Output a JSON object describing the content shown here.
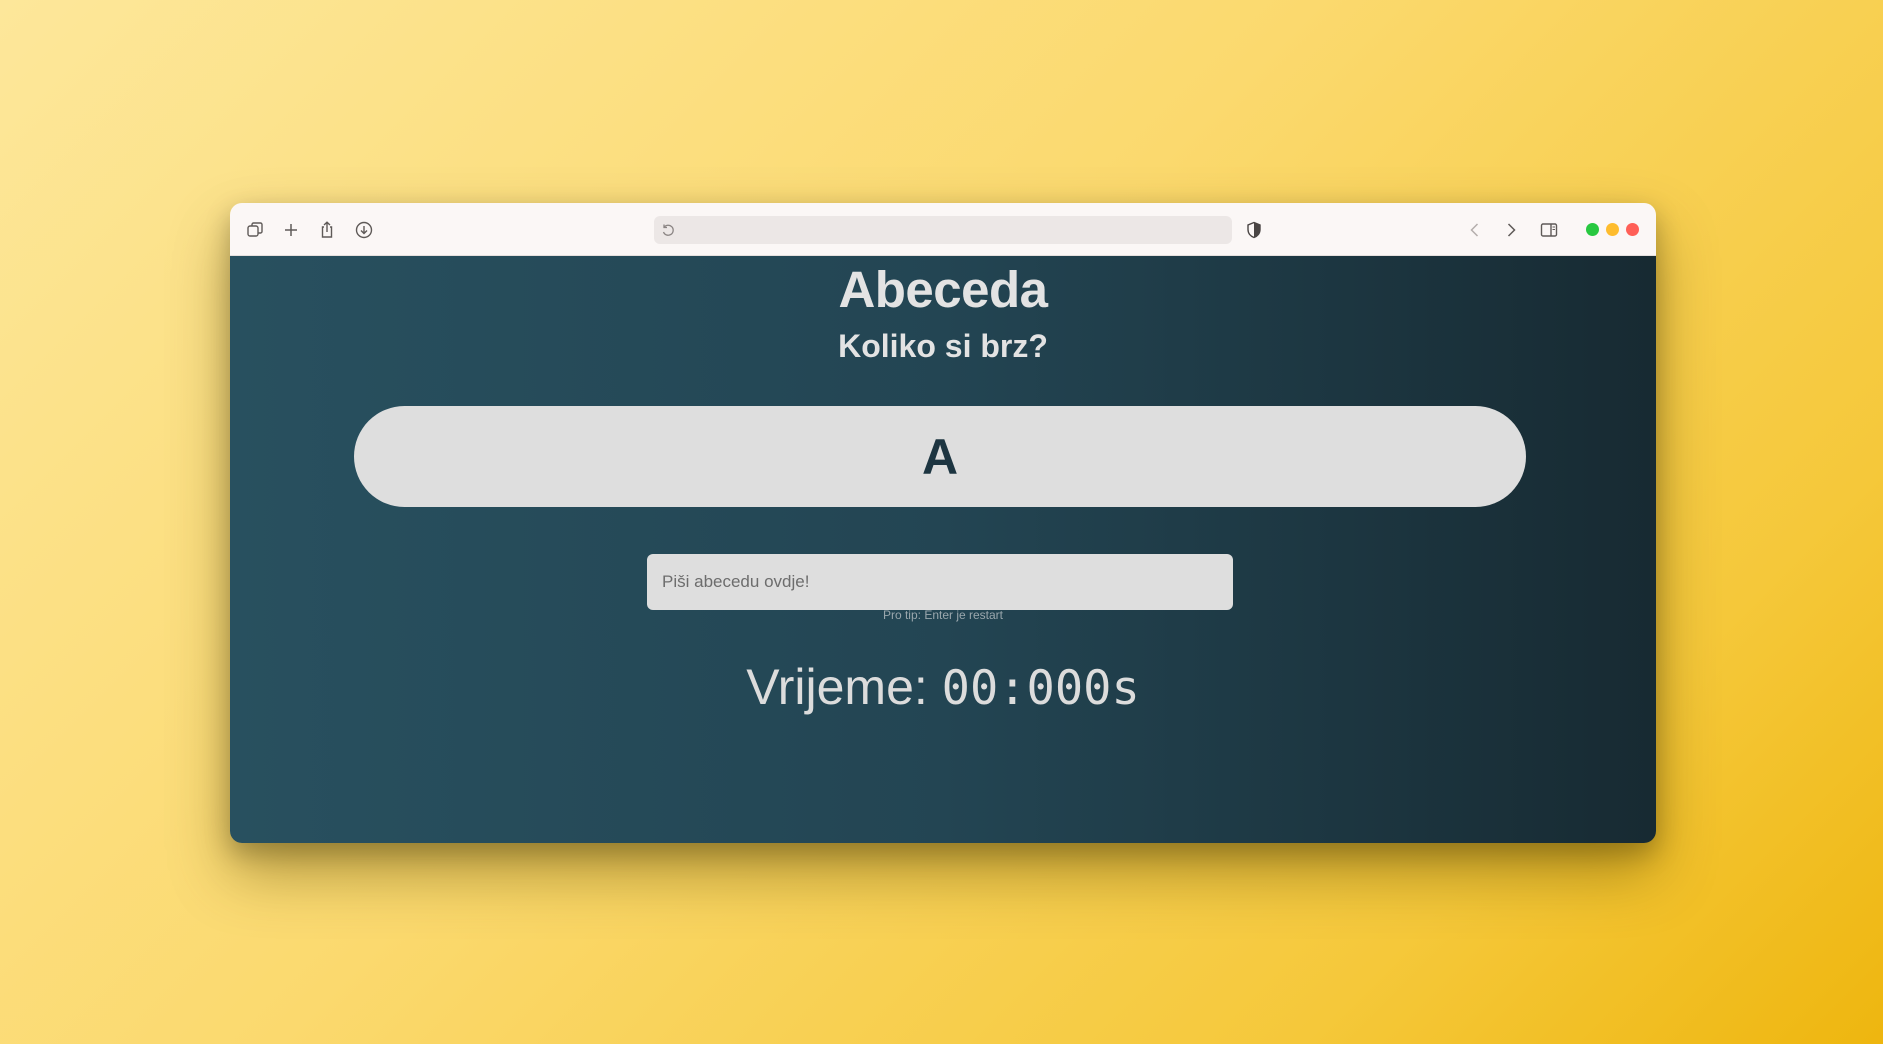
{
  "browser": {
    "toolbar_icons": [
      "tabs-overview-icon",
      "new-tab-icon",
      "share-icon",
      "download-icon"
    ],
    "address_bar": {
      "value": ""
    },
    "privacy_icon": "shield-icon",
    "nav": [
      "back-icon",
      "forward-icon",
      "sidebar-icon"
    ],
    "traffic_lights": {
      "green": "#28c840",
      "yellow": "#febc2e",
      "red": "#ff5f57"
    }
  },
  "page": {
    "title": "Abeceda",
    "subtitle": "Koliko si brz?",
    "current_letter": "A",
    "input_placeholder": "Piši abecedu ovdje!",
    "input_value": "",
    "tip": "Pro tip: Enter je restart",
    "time_label": "Vrijeme: ",
    "time_value": "00:000s"
  },
  "colors": {
    "background_accent": "#f5c83a",
    "content_bg": "#234553",
    "letter_color": "#1d3541"
  }
}
